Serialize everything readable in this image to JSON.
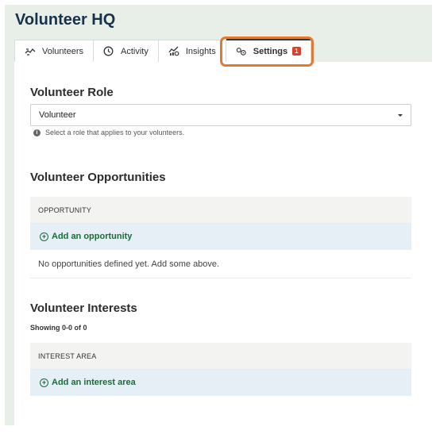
{
  "app": {
    "title": "Volunteer HQ"
  },
  "tabs": [
    {
      "label": "Volunteers",
      "icon": "handshake-icon",
      "active": false
    },
    {
      "label": "Activity",
      "icon": "clock-icon",
      "active": false
    },
    {
      "label": "Insights",
      "icon": "insights-chart-icon",
      "active": false
    },
    {
      "label": "Settings",
      "icon": "gears-icon",
      "active": true,
      "badge": "1"
    }
  ],
  "role": {
    "heading": "Volunteer Role",
    "selected": "Volunteer",
    "hint": "Select a role that applies to your volunteers."
  },
  "opportunities": {
    "heading": "Volunteer Opportunities",
    "column": "OPPORTUNITY",
    "add_label": "Add an opportunity",
    "empty": "No opportunities defined yet. Add some above."
  },
  "interests": {
    "heading": "Volunteer Interests",
    "showing": "Showing 0-0 of 0",
    "column": "INTEREST AREA",
    "add_label": "Add an interest area"
  },
  "colors": {
    "title": "#17324a",
    "active_tab_bar": "#1f3d57",
    "highlight": "#e07a35",
    "badge": "#d9412f",
    "add_link": "#1c6b3a",
    "add_row_bg": "#e6eff6",
    "frame_bg": "#e8efe9"
  }
}
